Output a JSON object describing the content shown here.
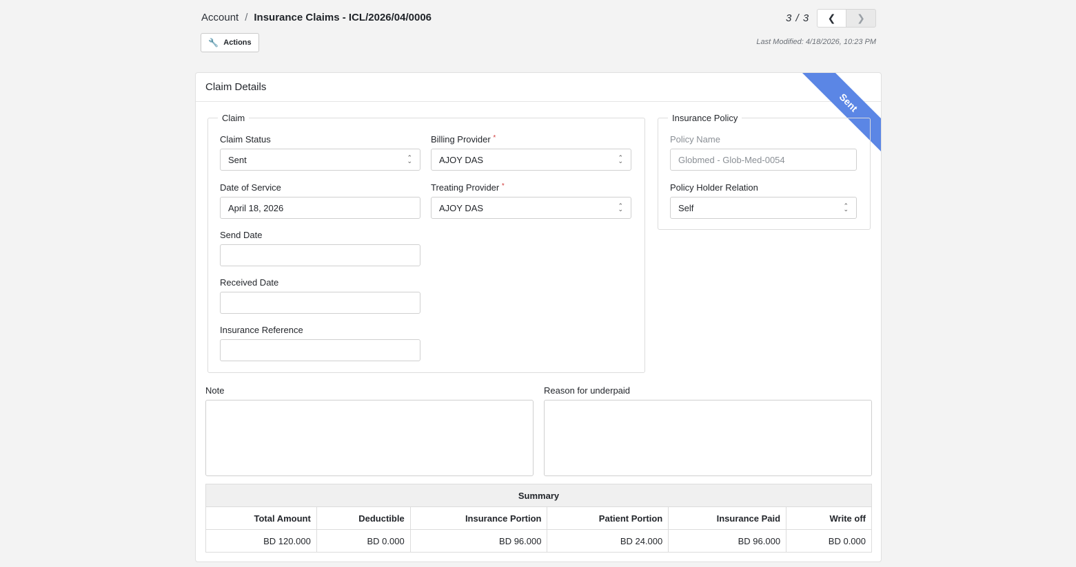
{
  "header": {
    "breadcrumb_root": "Account",
    "breadcrumb_sep": "/",
    "breadcrumb_current": "Insurance Claims - ICL/2026/04/0006",
    "pager_counter": "3 / 3",
    "pager_prev_icon": "chevron-left-icon",
    "pager_next_icon": "chevron-right-icon",
    "actions_label": "Actions",
    "last_modified": "Last Modified: 4/18/2026, 10:23 PM"
  },
  "card": {
    "title": "Claim Details",
    "ribbon": "Sent",
    "ribbon_color": "#5b86e5"
  },
  "claim": {
    "legend": "Claim",
    "claim_status_label": "Claim Status",
    "claim_status_value": "Sent",
    "billing_provider_label": "Billing Provider",
    "billing_provider_value": "AJOY DAS",
    "date_of_service_label": "Date of Service",
    "date_of_service_value": "April 18, 2026",
    "treating_provider_label": "Treating Provider",
    "treating_provider_value": "AJOY DAS",
    "send_date_label": "Send Date",
    "send_date_value": "",
    "received_date_label": "Received Date",
    "received_date_value": "",
    "insurance_reference_label": "Insurance Reference",
    "insurance_reference_value": "",
    "required_mark": "*"
  },
  "policy": {
    "legend": "Insurance Policy",
    "policy_name_label": "Policy Name",
    "policy_name_value": "Globmed - Glob-Med-0054",
    "holder_relation_label": "Policy Holder Relation",
    "holder_relation_value": "Self"
  },
  "notes": {
    "note_label": "Note",
    "reason_label": "Reason for underpaid"
  },
  "summary": {
    "title": "Summary",
    "columns": [
      "Total Amount",
      "Deductible",
      "Insurance Portion",
      "Patient Portion",
      "Insurance Paid",
      "Write off"
    ],
    "values": [
      "BD 120.000",
      "BD 0.000",
      "BD 96.000",
      "BD 24.000",
      "BD 96.000",
      "BD 0.000"
    ]
  }
}
